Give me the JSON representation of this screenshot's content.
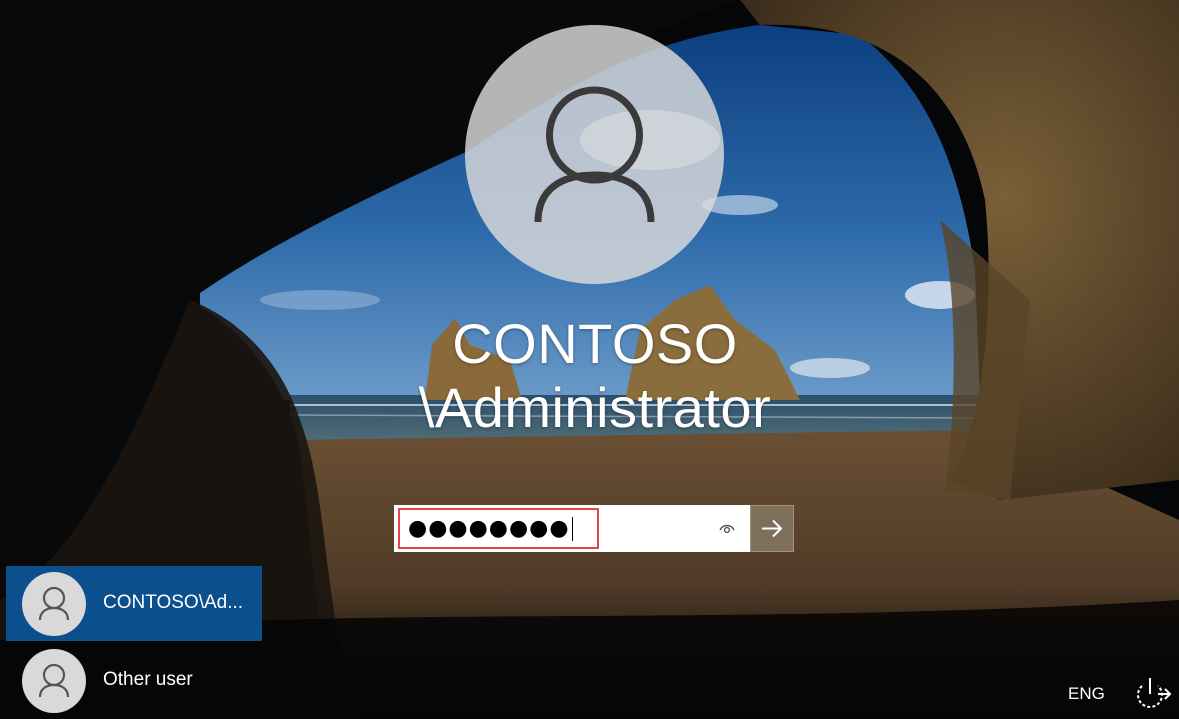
{
  "login": {
    "user_line1": "CONTOSO",
    "user_line2": "\\Administrator",
    "password_mask": "●●●●●●●●",
    "reveal_icon": "eye-icon",
    "submit_icon": "arrow-right-icon"
  },
  "user_list": [
    {
      "label": "CONTOSO\\Ad...",
      "selected": true
    },
    {
      "label": "Other user",
      "selected": false
    }
  ],
  "status_bar": {
    "language": "ENG",
    "ease_of_access_icon": "ease-of-access-icon"
  },
  "colors": {
    "selected_tile": "#0b4f8c",
    "password_focus_border": "#e0464a",
    "submit_button": "#7e6f5b",
    "avatar_circle": "#d9d9d9"
  }
}
